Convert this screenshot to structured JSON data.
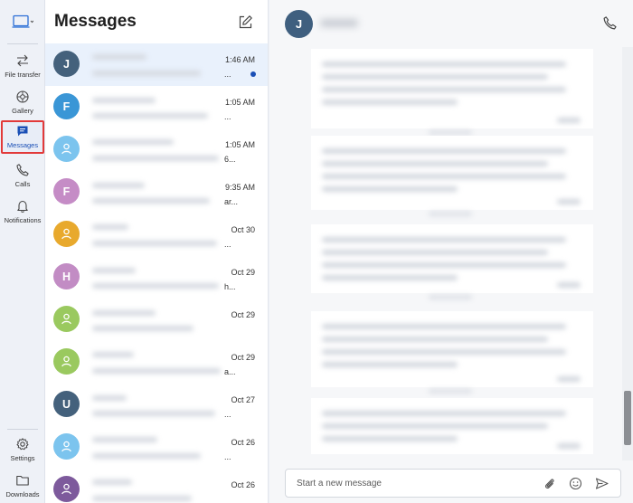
{
  "nav": {
    "items": [
      {
        "id": "file-transfer",
        "label": "File transfer",
        "icon": "arrows-swap-icon"
      },
      {
        "id": "gallery",
        "label": "Gallery",
        "icon": "gallery-icon"
      },
      {
        "id": "messages",
        "label": "Messages",
        "icon": "chat-bubble-icon",
        "active": true
      },
      {
        "id": "calls",
        "label": "Calls",
        "icon": "phone-icon"
      },
      {
        "id": "notifications",
        "label": "Notifications",
        "icon": "bell-icon"
      }
    ],
    "bottom": [
      {
        "id": "settings",
        "label": "Settings",
        "icon": "gear-icon"
      },
      {
        "id": "downloads",
        "label": "Downloads",
        "icon": "folder-icon"
      }
    ]
  },
  "list": {
    "title": "Messages",
    "conversations": [
      {
        "initial": "J",
        "avatar_color": "#44617c",
        "time": "1:46 AM",
        "snippet": "...",
        "unread": true,
        "selected": true
      },
      {
        "initial": "F",
        "avatar_color": "#3a96d6",
        "time": "1:05 AM",
        "snippet": "..."
      },
      {
        "initial": "",
        "avatar_color": "#7cc4ee",
        "time": "1:05 AM",
        "snippet": "6..."
      },
      {
        "initial": "F",
        "avatar_color": "#c58cc6",
        "time": "9:35 AM",
        "snippet": "ar..."
      },
      {
        "initial": "",
        "avatar_color": "#e8a92d",
        "time": "Oct 30",
        "snippet": "..."
      },
      {
        "initial": "H",
        "avatar_color": "#c28cc4",
        "time": "Oct 29",
        "snippet": "h..."
      },
      {
        "initial": "",
        "avatar_color": "#9ac95f",
        "time": "Oct 29",
        "snippet": ""
      },
      {
        "initial": "",
        "avatar_color": "#9ac95f",
        "time": "Oct 29",
        "snippet": "a..."
      },
      {
        "initial": "U",
        "avatar_color": "#44617c",
        "time": "Oct 27",
        "snippet": "..."
      },
      {
        "initial": "",
        "avatar_color": "#7cc4ee",
        "time": "Oct 26",
        "snippet": "..."
      },
      {
        "initial": "",
        "avatar_color": "#7d5a9c",
        "time": "Oct 26",
        "snippet": ""
      }
    ]
  },
  "chat": {
    "contact_initial": "J",
    "composer_placeholder": "Start a new message"
  },
  "colors": {
    "accent": "#1a4fb6",
    "highlight_border": "#e23a3a",
    "selected_row": "#e9f1fc"
  }
}
